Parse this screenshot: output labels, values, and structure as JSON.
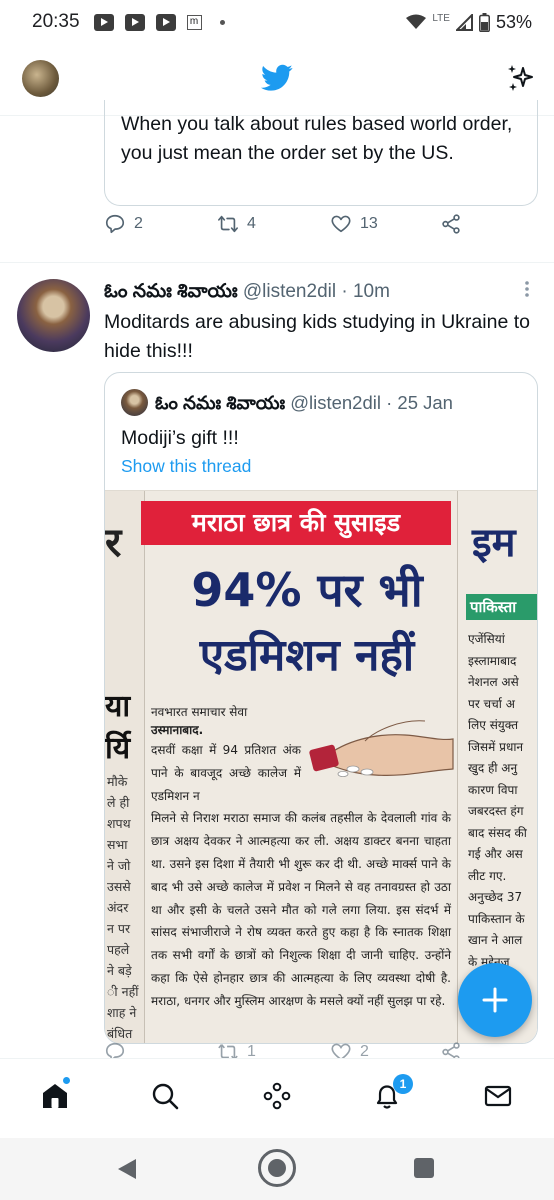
{
  "status_bar": {
    "time": "20:35",
    "notif_m": "m",
    "network": "LTE",
    "battery": "53%"
  },
  "header": {
    "logo": "twitter-bird-icon",
    "right_icon": "sparkle-icon"
  },
  "previous_tweet": {
    "quote_text": "When you talk about rules based world order, you just mean the order set by the US.",
    "replies": "2",
    "retweets": "4",
    "likes": "13"
  },
  "tweet": {
    "display_name": "ఓం నమః శివాయః",
    "handle": "@listen2dil",
    "separator": "·",
    "time": "10m",
    "text": "Moditards are abusing kids studying in Ukraine to hide this!!!",
    "quoted": {
      "display_name": "ఓం నమః శివాయః",
      "handle": "@listen2dil",
      "separator": "·",
      "date": "25 Jan",
      "text": "Modiji’s gift !!!",
      "show_thread": "Show this thread"
    },
    "replies": "",
    "retweets": "1",
    "likes": "2"
  },
  "newspaper": {
    "banner": "मराठा छात्र की सुसाइड",
    "headline1": "94% पर भी",
    "headline2": "एडमिशन नहीं",
    "byline1": "नवभारत समाचार सेवा",
    "byline2": "उस्मानाबाद.",
    "lead": "दसवीं कक्षा में 94 प्रतिशत अंक पाने के बावजूद अच्छे कालेज में एडमिशन न",
    "article": "मिलने से निराश मराठा समाज की कलंब तहसील के देवलाली गांव के छात्र अक्षय देवकर ने आत्महत्या कर ली. अक्षय डाक्टर बनना चाहता था. उसने इस दिशा में तैयारी भी शुरू कर दी थी. अच्छे मार्क्स पाने के बाद भी उसे अच्छे कालेज में प्रवेश न मिलने से वह तनावग्रस्त हो उठा था और इसी के चलते उसने मौत को गले लगा लिया. इस संदर्भ में सांसद संभाजीराजे ने रोष व्यक्त करते हुए कहा है कि स्नातक शिक्षा तक सभी वर्गों के छात्रों को निशुल्क शिक्षा दी जानी चाहिए. उन्होंने कहा कि ऐसे होनहार छात्र की आत्महत्या के लिए व्यवस्था दोषी है. मराठा, धनगर और मुस्लिम आरक्षण के मसले क्यों नहीं सुलझ पा रहे.",
    "left_big": "र",
    "left_mid": "या\nर्यि",
    "left_col": "मौके\nले ही\nशपथ\nसभा\nने जो\nउससे\nअंदर\nन पर\nपहले\nने बड़े\nी नहीं\nशाह ने\nबंधित",
    "right_big": "इम",
    "right_bar": "पाकिस्ता",
    "right_col": "एजेंसियां\nइस्लामाबाद\nनेशनल असे\nपर चर्चा अ\nलिए संयुक्त\nजिसमें प्रधान\nखुद ही अनु\nकारण विपा\nजबरदस्त हंग\nबाद संसद की\nगई और अस\nलीट गए.\nअनुच्छेद 37\nपाकिस्तान के\nखान ने आल\nके मद्देनज\nआरिफ अल्व"
  },
  "bottom_nav": {
    "home": "home-icon",
    "search": "search-icon",
    "spaces": "spaces-icon",
    "notifications": "bell-icon",
    "notifications_badge": "1",
    "messages": "mail-icon"
  },
  "colors": {
    "accent": "#1d9bf0",
    "text": "#0f1419",
    "muted": "#536471",
    "banner_red": "#e0213a",
    "headline_navy": "#1a2a6b"
  }
}
